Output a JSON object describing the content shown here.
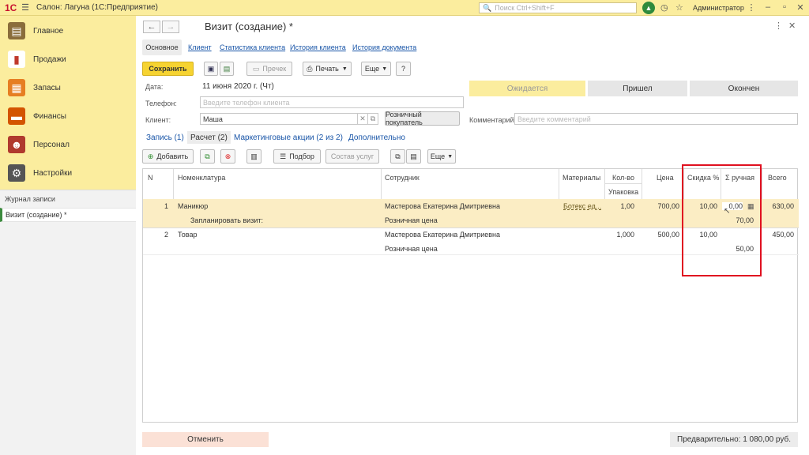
{
  "app": {
    "logo": "1С",
    "title": "Салон: Лагуна  (1С:Предприятие)",
    "search_placeholder": "Поиск Ctrl+Shift+F",
    "user": "Администратор"
  },
  "sidebar": {
    "items": [
      {
        "label": "Главное",
        "icon": "main-icon",
        "color": "#8a6d3b"
      },
      {
        "label": "Продажи",
        "icon": "sales-icon",
        "color": "#c0392b"
      },
      {
        "label": "Запасы",
        "icon": "stock-icon",
        "color": "#e67e22"
      },
      {
        "label": "Финансы",
        "icon": "finance-icon",
        "color": "#d35400"
      },
      {
        "label": "Персонал",
        "icon": "staff-icon",
        "color": "#b03a2e"
      },
      {
        "label": "Настройки",
        "icon": "settings-icon",
        "color": "#555555"
      }
    ],
    "journal": "Журнал записи",
    "current": "Визит (создание) *"
  },
  "form": {
    "title": "Визит (создание) *",
    "tabs": [
      "Основное",
      "Клиент",
      "Статистика клиента",
      "История клиента",
      "История документа"
    ],
    "toolbar": {
      "save": "Сохранить",
      "receipt": "Пречек",
      "print": "Печать",
      "more": "Еще",
      "help": "?"
    },
    "fields": {
      "date_label": "Дата:",
      "date_value": "11 июня 2020 г. (Чт)",
      "phone_label": "Телефон:",
      "phone_placeholder": "Введите телефон клиента",
      "client_label": "Клиент:",
      "client_value": "Маша",
      "retail_buyer": "Розничный покупатель",
      "comment_label": "Комментарий:",
      "comment_placeholder": "Введите комментарий"
    },
    "status": {
      "expected": "Ожидается",
      "arrived": "Пришел",
      "finished": "Окончен"
    },
    "subtabs": {
      "record": "Запись (1)",
      "calc": "Расчет (2)",
      "marketing": "Маркетинговые акции (2 из 2)",
      "extra": "Дополнительно"
    },
    "table_toolbar": {
      "add": "Добавить",
      "pick": "Подбор",
      "services": "Состав услуг",
      "more": "Еще"
    },
    "columns": {
      "n": "N",
      "item": "Номенклатура",
      "employee": "Сотрудник",
      "materials": "Материалы",
      "qty": "Кол-во",
      "pack": "Упаковка",
      "price": "Цена",
      "discount": "Скидка %",
      "manual": "Σ ручная",
      "total": "Всего"
    },
    "rows": [
      {
        "n": "1",
        "item": "Маникюр",
        "sub": "Запланировать визит:",
        "employee": "Мастерова Екатерина Дмитриевна",
        "price_type": "Розничная цена",
        "materials": "Ботекс ед...",
        "qty": "1,00",
        "price": "700,00",
        "discount": "10,00",
        "manual": "0,00",
        "manual_sum": "70,00",
        "total": "630,00"
      },
      {
        "n": "2",
        "item": "Товар",
        "sub": "",
        "employee": "Мастерова Екатерина Дмитриевна",
        "price_type": "Розничная цена",
        "materials": "",
        "qty": "1,000",
        "price": "500,00",
        "discount": "10,00",
        "manual": "",
        "manual_sum": "50,00",
        "total": "450,00"
      }
    ],
    "cancel": "Отменить",
    "total": "Предварительно: 1 080,00 руб."
  }
}
